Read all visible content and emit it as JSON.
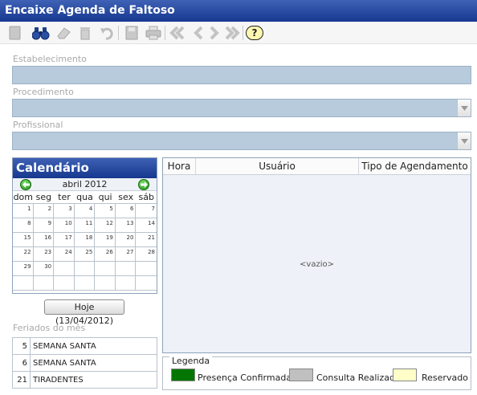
{
  "window": {
    "title": "Encaixe Agenda de Faltoso"
  },
  "toolbar": {
    "buttons": [
      {
        "name": "new-icon"
      },
      {
        "name": "search-binoculars-icon"
      },
      {
        "name": "eraser-icon"
      },
      {
        "name": "trash-icon"
      },
      {
        "name": "undo-icon"
      },
      {
        "name": "save-disk-icon"
      },
      {
        "name": "print-icon"
      },
      {
        "name": "first-record-icon"
      },
      {
        "name": "previous-record-icon"
      },
      {
        "name": "next-record-icon"
      },
      {
        "name": "last-record-icon"
      },
      {
        "name": "help-icon"
      }
    ],
    "help_label": "?"
  },
  "form": {
    "estabelecimento": {
      "label": "Estabelecimento",
      "value": ""
    },
    "procedimento": {
      "label": "Procedimento",
      "value": ""
    },
    "profissional": {
      "label": "Profissional",
      "value": ""
    }
  },
  "calendar": {
    "title": "Calendário",
    "month": "abril 2012",
    "weekdays": [
      "dom",
      "seg",
      "ter",
      "qua",
      "qui",
      "sex",
      "sáb"
    ],
    "weeks": [
      [
        "1",
        "2",
        "3",
        "4",
        "5",
        "6",
        "7"
      ],
      [
        "8",
        "9",
        "10",
        "11",
        "12",
        "13",
        "14"
      ],
      [
        "15",
        "16",
        "17",
        "18",
        "19",
        "20",
        "21"
      ],
      [
        "22",
        "23",
        "24",
        "25",
        "26",
        "27",
        "28"
      ],
      [
        "29",
        "30",
        "",
        "",
        "",
        "",
        ""
      ],
      [
        "",
        "",
        "",
        "",
        "",
        "",
        ""
      ]
    ],
    "today_button": "Hoje (13/04/2012)"
  },
  "feriados": {
    "label": "Feriados do mês",
    "items": [
      {
        "day": "5",
        "name": "SEMANA SANTA"
      },
      {
        "day": "6",
        "name": "SEMANA SANTA"
      },
      {
        "day": "21",
        "name": "TIRADENTES"
      }
    ]
  },
  "grid": {
    "columns": [
      "Hora",
      "Usuário",
      "Tipo de Agendamento"
    ],
    "empty_text": "<vazio>"
  },
  "legend": {
    "title": "Legenda",
    "items": [
      {
        "label": "Presença Confirmada",
        "color": "#047604"
      },
      {
        "label": "Consulta Realizada",
        "color": "#c0c0c0"
      },
      {
        "label": "Reservado",
        "color": "#fffec8"
      }
    ]
  }
}
